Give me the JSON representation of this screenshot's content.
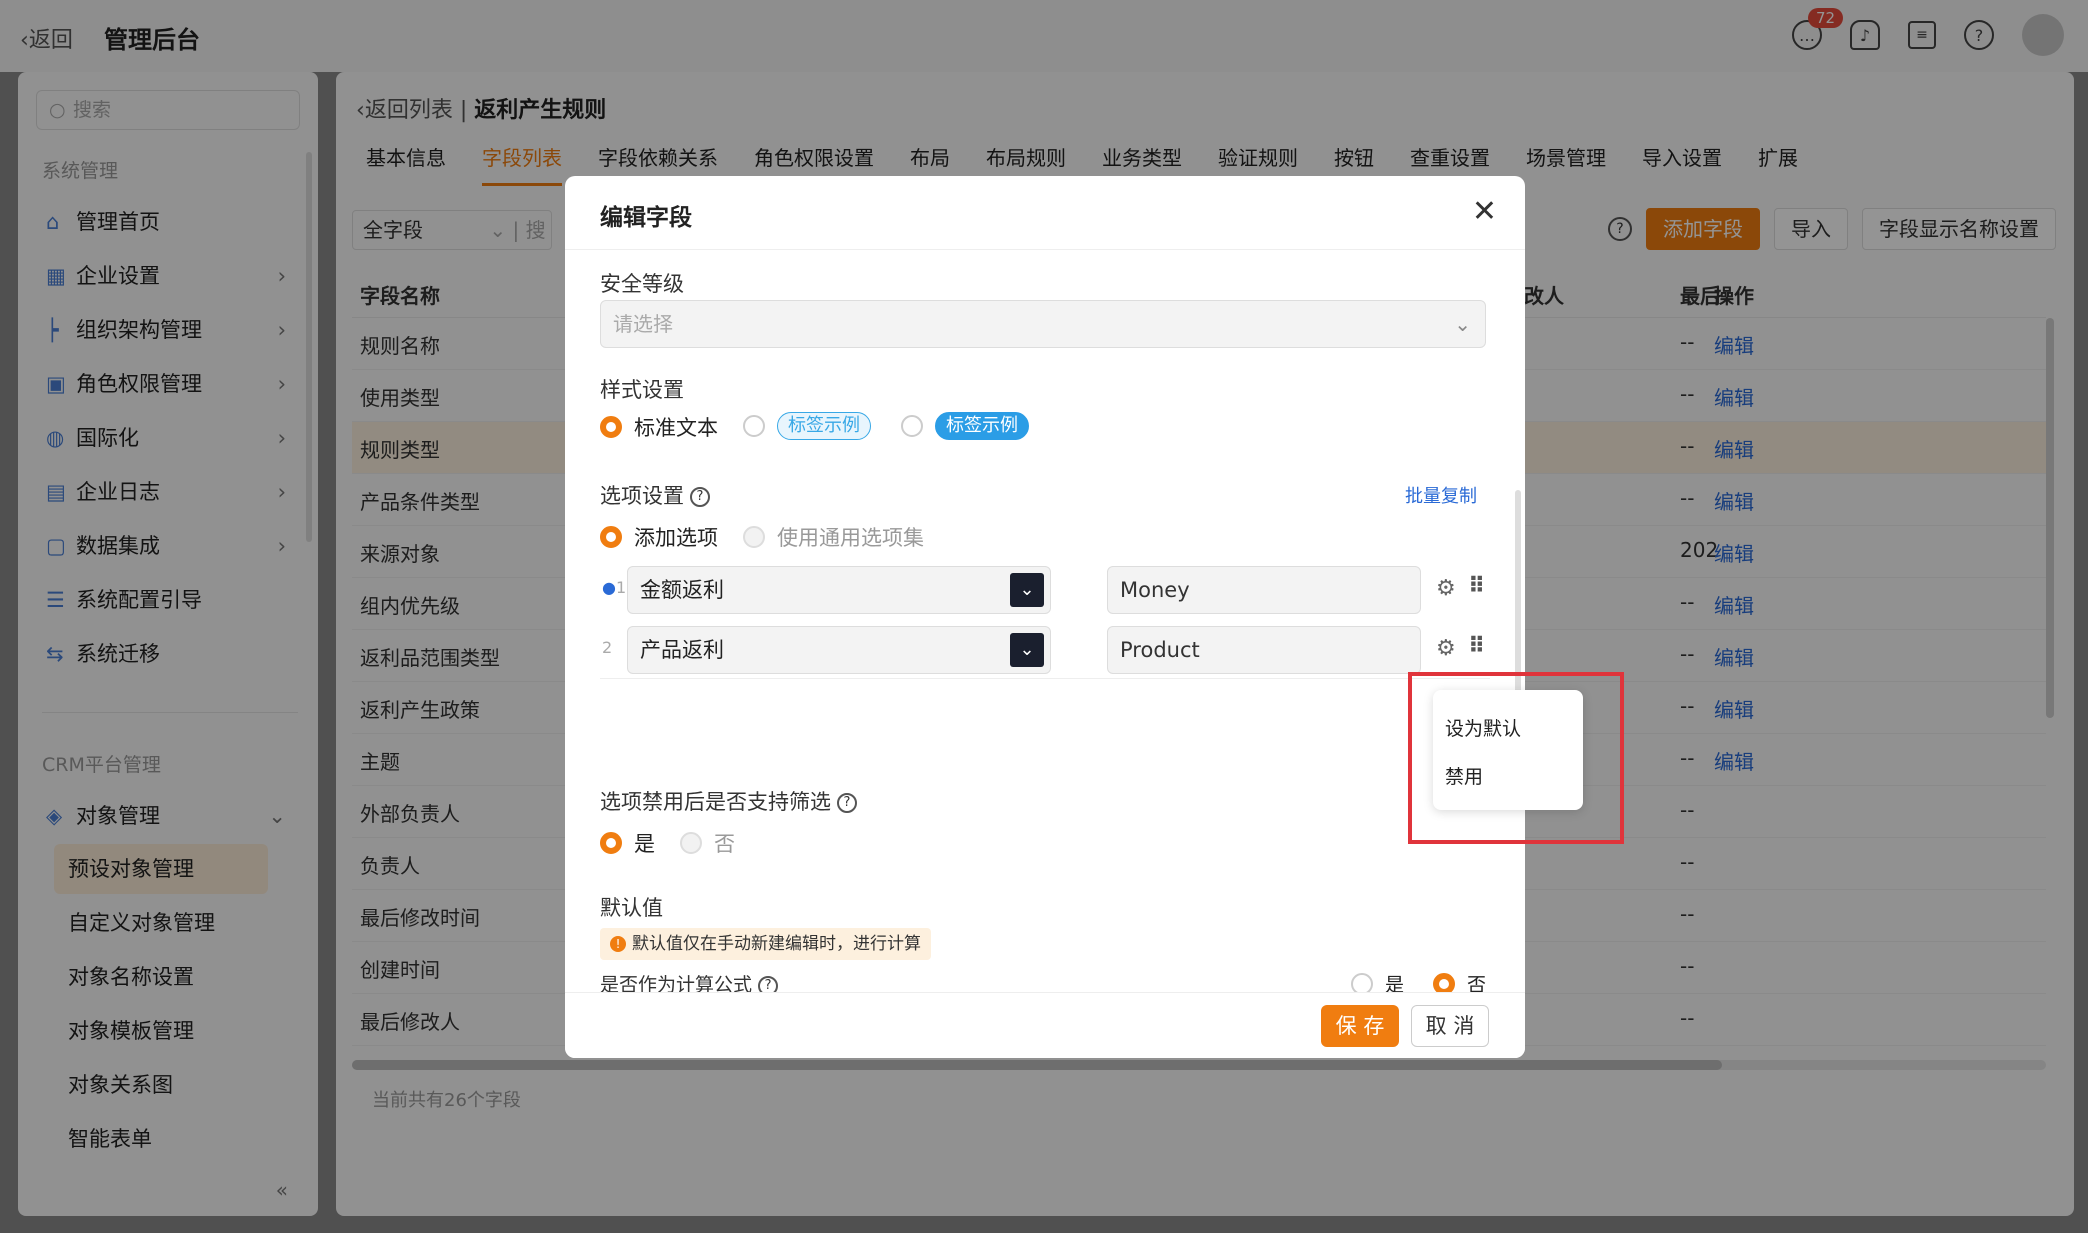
{
  "topbar": {
    "back_label": "返回",
    "title": "管理后台",
    "badge_count": "72",
    "icons": [
      "chat-icon",
      "bell-icon",
      "notes-icon",
      "help-icon",
      "avatar"
    ]
  },
  "sidebar": {
    "search_placeholder": "搜索",
    "section_system": "系统管理",
    "items": [
      {
        "label": "管理首页",
        "icon": "home-icon"
      },
      {
        "label": "企业设置",
        "icon": "building-icon"
      },
      {
        "label": "组织架构管理",
        "icon": "org-icon"
      },
      {
        "label": "角色权限管理",
        "icon": "role-icon"
      },
      {
        "label": "国际化",
        "icon": "globe-icon"
      },
      {
        "label": "企业日志",
        "icon": "log-icon"
      },
      {
        "label": "数据集成",
        "icon": "chip-icon"
      },
      {
        "label": "系统配置引导",
        "icon": "guide-icon"
      },
      {
        "label": "系统迁移",
        "icon": "migrate-icon"
      }
    ],
    "section_crm": "CRM平台管理",
    "object_mgmt": "对象管理",
    "sub_items": [
      "预设对象管理",
      "自定义对象管理",
      "对象名称设置",
      "对象模板管理",
      "对象关系图",
      "智能表单"
    ],
    "collapse": "«"
  },
  "main": {
    "crumb_back": "返回列表",
    "crumb_title": "返利产生规则",
    "tabs": [
      "基本信息",
      "字段列表",
      "字段依赖关系",
      "角色权限设置",
      "布局",
      "布局规则",
      "业务类型",
      "验证规则",
      "按钮",
      "查重设置",
      "场景管理",
      "导入设置",
      "扩展"
    ],
    "filter_value": "全字段",
    "search_partial": "搜",
    "toolbar": {
      "add": "添加字段",
      "import": "导入",
      "display_name": "字段显示名称设置"
    },
    "columns": {
      "name": "字段名称",
      "modifier": "改人",
      "last": "最后",
      "ops": "操作"
    },
    "rows": [
      {
        "name": "规则名称",
        "last": "--",
        "op": "编辑"
      },
      {
        "name": "使用类型",
        "last": "--",
        "op": "编辑"
      },
      {
        "name": "规则类型",
        "last": "--",
        "op": "编辑"
      },
      {
        "name": "产品条件类型",
        "last": "--",
        "op": "编辑"
      },
      {
        "name": "来源对象",
        "last": "202",
        "op": "编辑"
      },
      {
        "name": "组内优先级",
        "last": "--",
        "op": "编辑"
      },
      {
        "name": "返利品范围类型",
        "last": "--",
        "op": "编辑"
      },
      {
        "name": "返利产生政策",
        "last": "--",
        "op": "编辑"
      },
      {
        "name": "主题",
        "last": "--",
        "op": "编辑"
      },
      {
        "name": "外部负责人",
        "last": "--",
        "op": ""
      },
      {
        "name": "负责人",
        "last": "--",
        "op": ""
      },
      {
        "name": "最后修改时间",
        "last": "--",
        "op": ""
      },
      {
        "name": "创建时间",
        "last": "--",
        "op": ""
      },
      {
        "name": "最后修改人",
        "last": "--",
        "op": ""
      }
    ],
    "footer": "当前共有26个字段"
  },
  "modal": {
    "title": "编辑字段",
    "security_label": "安全等级",
    "security_placeholder": "请选择",
    "style_label": "样式设置",
    "style_options": [
      "标准文本",
      "标签示例",
      "标签示例"
    ],
    "options_label": "选项设置",
    "batch_copy": "批量复制",
    "option_source": [
      "添加选项",
      "使用通用选项集"
    ],
    "options": [
      {
        "num": "1",
        "name": "金额返利",
        "value": "Money"
      },
      {
        "num": "2",
        "name": "产品返利",
        "value": "Product"
      }
    ],
    "filter_label": "选项禁用后是否支持筛选",
    "filter_choices": [
      "是",
      "否"
    ],
    "default_label": "默认值",
    "default_warning": "默认值仅在手动新建编辑时，进行计算",
    "formula_label": "是否作为计算公式",
    "formula_choices": [
      "是",
      "否"
    ],
    "save": "保 存",
    "cancel": "取 消"
  },
  "popover": {
    "set_default": "设为默认",
    "disable": "禁用"
  },
  "colors": {
    "accent": "#f07d10",
    "link": "#2a6ad6",
    "highlight_box": "#e0343b"
  }
}
